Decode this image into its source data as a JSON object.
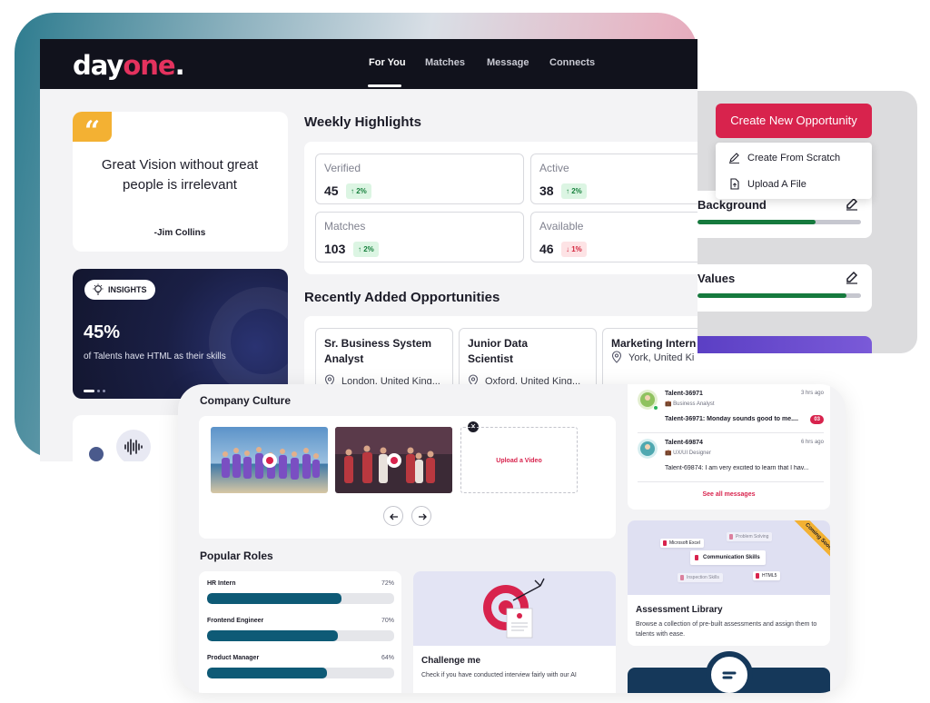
{
  "brand": {
    "logo_main": "day",
    "logo_accent": "one",
    "logo_dot": "."
  },
  "nav": {
    "tabs": [
      {
        "label": "For You",
        "active": true
      },
      {
        "label": "Matches"
      },
      {
        "label": "Message"
      },
      {
        "label": "Connects"
      }
    ]
  },
  "quote": {
    "icon": "quote-icon",
    "text": "Great Vision without great people is irrelevant",
    "author": "-Jim Collins"
  },
  "insights": {
    "badge": "INSIGHTS",
    "icon": "lightbulb-icon",
    "value": "45%",
    "text": "of Talents have HTML as their skills"
  },
  "weekly": {
    "title": "Weekly Highlights",
    "stats": [
      {
        "label": "Verified",
        "value": "45",
        "delta": "2%",
        "direction": "up"
      },
      {
        "label": "Active",
        "value": "38",
        "delta": "2%",
        "direction": "up"
      },
      {
        "label": "Matches",
        "value": "103",
        "delta": "2%",
        "direction": "up"
      },
      {
        "label": "Available",
        "value": "46",
        "delta": "1%",
        "direction": "down"
      }
    ]
  },
  "recent": {
    "title": "Recently Added Opportunities",
    "items": [
      {
        "title": "Sr. Business System Analyst",
        "location": "London, United King..."
      },
      {
        "title": "Junior Data Scientist",
        "location": "Oxford, United King..."
      },
      {
        "title": "Marketing Intern",
        "location": "York, United Ki"
      }
    ]
  },
  "create": {
    "button": "Create New Opportunity",
    "menu": [
      {
        "label": "Create From Scratch",
        "icon": "pencil-icon"
      },
      {
        "label": "Upload A File",
        "icon": "file-upload-icon"
      }
    ]
  },
  "profile_sections": [
    {
      "label": "Background",
      "progress": 0.72
    },
    {
      "label": "Values",
      "progress": 0.91
    }
  ],
  "culture": {
    "title": "Company Culture",
    "upload_label": "Upload a Video"
  },
  "roles": {
    "title": "Popular Roles",
    "items": [
      {
        "name": "HR Intern",
        "percent": "72%",
        "value": 72
      },
      {
        "name": "Frontend Engineer",
        "percent": "70%",
        "value": 70
      },
      {
        "name": "Product Manager",
        "percent": "64%",
        "value": 64
      }
    ]
  },
  "challenge": {
    "title": "Challenge me",
    "desc": "Check if you have conducted interview fairly with our AI"
  },
  "messages": {
    "items": [
      {
        "name": "Talent-36971",
        "role": "Business Analyst",
        "time": "3 hrs ago",
        "text": "Talent-36971: Monday sounds good to me....",
        "count": "03",
        "unread": true
      },
      {
        "name": "Talent-69874",
        "role": "UX/UI Designer",
        "time": "6 hrs ago",
        "text": "Talent-69874: I am very excited to learn that I hav...",
        "unread": false
      }
    ],
    "see_all": "See all messages"
  },
  "assessment": {
    "badge": "Coming Soon",
    "chips": [
      "Microsoft Excel",
      "Problem Solving",
      "Communication Skills",
      "HTML5",
      "Inspection Skills"
    ],
    "title": "Assessment Library",
    "desc": "Browse a collection of pre-built assessments and assign them to talents with ease."
  },
  "colors": {
    "brand": "#d8234d",
    "nav": "#11121c",
    "accent_yellow": "#f3b133",
    "progress_green": "#167a3e",
    "role_bar": "#0e5a76"
  }
}
